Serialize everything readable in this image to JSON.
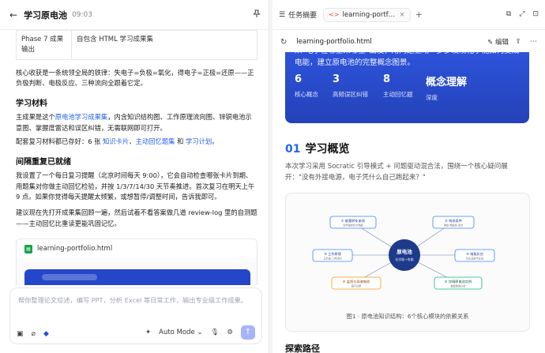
{
  "left": {
    "title": "学习原电池",
    "time": "09:03",
    "table": [
      {
        "c1": "Phase 7 成果输出",
        "c2": "自包含 HTML 学习成果集"
      }
    ],
    "core_text": "核心收获是一条统领全局的铁律：失电子=负极=氧化，得电子=正极=还原——正负极判断、电极反应、三种流向全跟着它定。",
    "section_materials": "学习材料",
    "materials_pre": "主成果是这个",
    "materials_link": "原电池学习成果集",
    "materials_post": "，内含知识结构图、工作原理流向图、锌铜电池示意图、掌握度雷达和误区纠错，无需联网即可打开。",
    "support_pre": "配套复习材料都已存好：6 张",
    "support_link1": "知识卡片",
    "support_sep1": "、",
    "support_link2": "主动回忆题集",
    "support_and": " 和 ",
    "support_link3": "学习计划",
    "support_end": "。",
    "section_review": "间隔重复已就绪",
    "review_text": "我设置了一个每日复习提醒（北京时间每天 9:00），它会自动检查哪张卡片到期、用题集对你做主动回忆检验，并按 1/3/7/14/30 天节奏推进。首次复习在明天上午 9 点。如果你觉得每天提醒太频繁，或想暂停/调整时间，告诉我即可。",
    "suggest_text": "建议现在先打开成果集回顾一遍，然后试着不看答案做几道 review-log 里的自测题——主动回忆比重读更能巩固记忆。",
    "file_name": "learning-portfolio.html",
    "composer_placeholder": "帮你整理论文综述，编写 PPT，分析 Excel 等日常工作，输出专业级工作成果。",
    "mode_label": "Auto Mode"
  },
  "right": {
    "task_label": "任务摘要",
    "tab_label": "learning-portfolio.html",
    "url": "learning-portfolio.html",
    "edit_label": "编辑",
    "hero_text": "从\"电子在哪里来哪里\"出发，用问题驱动一步步发现化学能如何变成电能，建立原电池的完整概念图景。",
    "stats": [
      {
        "n": "6",
        "l": "核心概念"
      },
      {
        "n": "3",
        "l": "高频误区纠错"
      },
      {
        "n": "8",
        "l": "主动回忆题"
      },
      {
        "n": "概念理解",
        "l": "深度"
      }
    ],
    "section_num": "01",
    "section_title": "学习概览",
    "intro_text": "本次学习采用 Socratic 引导模式 + 问题驱动混合法，围绕一个核心疑问展开：\"没有外接电源，电子凭什么自己跑起来？\"",
    "diagram": {
      "center_title": "原电池",
      "center_sub": "化学能→电能",
      "nodes": [
        {
          "t": "① 能量转化本质",
          "s": "化学能转化为电能"
        },
        {
          "t": "② 构成条件",
          "s": "两极·电解质·闭合"
        },
        {
          "t": "③ 工作原理",
          "s": "正负极·三种流向"
        },
        {
          "t": "④ 电极反应",
          "s": "氧化还原半反应"
        },
        {
          "t": "⑤ 盐桥与双液电池",
          "s": "离子迁移"
        },
        {
          "t": "⑥ 锌铜原电池实例",
          "s": "典型装置分析"
        }
      ],
      "caption": "图1 · 原电池知识结构：6个核心模块的依赖关系"
    },
    "next_section": "探索路径"
  },
  "colors": {
    "accent": "#2563eb",
    "hero": "#2446c8",
    "file_icon": "#16a34a",
    "tab_icon": "#ef4444"
  }
}
